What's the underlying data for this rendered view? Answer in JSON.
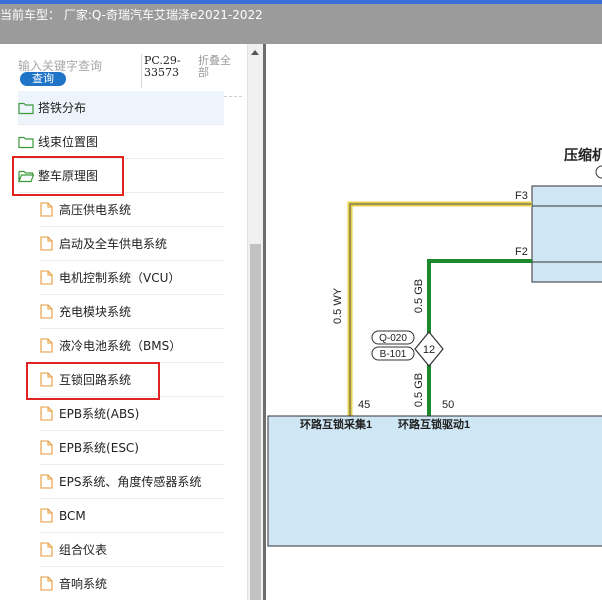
{
  "header": {
    "vehicle_type": "当前车型： 厂家:Q-奇瑞汽车艾瑞泽e2021-2022"
  },
  "search": {
    "placeholder": "输入关键字查询",
    "button_label": "查询",
    "pc_code": "PC.29-33573",
    "collapse_all": "折叠全部"
  },
  "tree": {
    "items": [
      {
        "label": "搭铁分布",
        "icon": "folder-icon"
      },
      {
        "label": "线束位置图",
        "icon": "folder-icon"
      },
      {
        "label": "整车原理图",
        "icon": "folder-open-icon"
      },
      {
        "label": "高压供电系统",
        "icon": "document-icon"
      },
      {
        "label": "启动及全车供电系统",
        "icon": "document-icon"
      },
      {
        "label": "电机控制系统（VCU）",
        "icon": "document-icon"
      },
      {
        "label": "充电模块系统",
        "icon": "document-icon"
      },
      {
        "label": "液冷电池系统（BMS）",
        "icon": "document-icon"
      },
      {
        "label": "互锁回路系统",
        "icon": "document-icon"
      },
      {
        "label": "EPB系统(ABS)",
        "icon": "document-icon"
      },
      {
        "label": "EPB系统(ESC)",
        "icon": "document-icon"
      },
      {
        "label": "EPS系统、角度传感器系统",
        "icon": "document-icon"
      },
      {
        "label": "BCM",
        "icon": "document-icon"
      },
      {
        "label": "组合仪表",
        "icon": "document-icon"
      },
      {
        "label": "音响系统",
        "icon": "document-icon"
      }
    ]
  },
  "diagram": {
    "component_title": "压缩机",
    "pin_f3": "F3",
    "pin_f2": "F2",
    "wire_wy": "0.5 WY",
    "wire_gb_upper": "0.5 GB",
    "wire_gb_lower": "0.5 GB",
    "connector_q": "Q-020",
    "connector_b": "B-101",
    "junction_number": "12",
    "pin_45": "45",
    "pin_50": "50",
    "label_collect": "环路互锁采集1",
    "label_drive": "环路互锁驱动1",
    "colors": {
      "wire_yellow": "#e6d24a",
      "wire_green": "#1c8a2c",
      "component_fill": "#cfe6f4",
      "highlight_red": "#e02424"
    }
  }
}
